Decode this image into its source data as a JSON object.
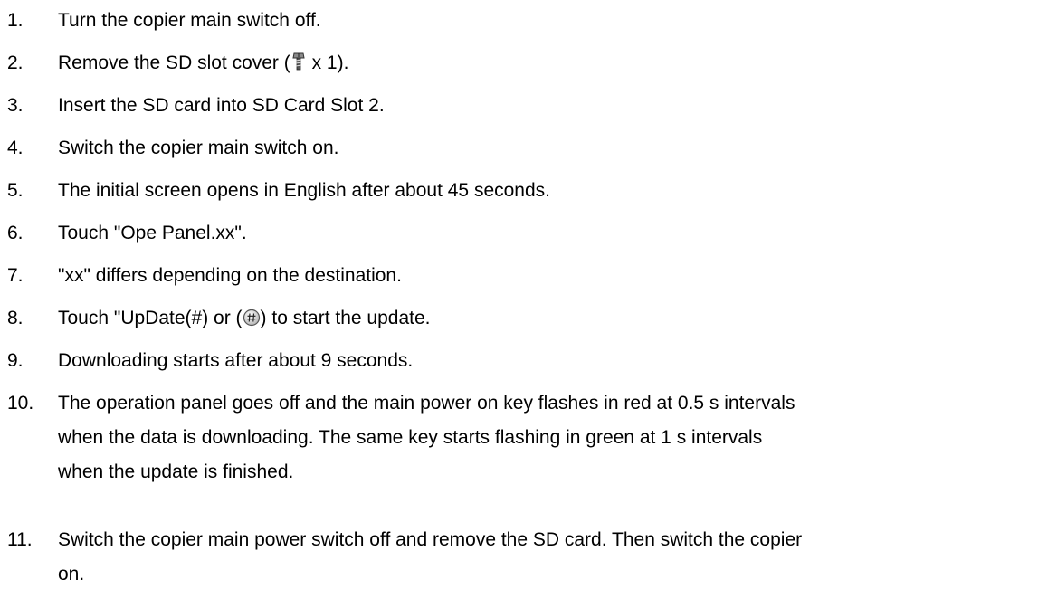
{
  "steps": [
    {
      "num": "1.",
      "text": "Turn the copier main switch off."
    },
    {
      "num": "2.",
      "before": "Remove the SD slot cover (",
      "after": " x 1).",
      "icon": "screw-icon"
    },
    {
      "num": "3.",
      "text": "Insert the SD card into SD Card Slot 2."
    },
    {
      "num": "4.",
      "text": "Switch the copier main switch on."
    },
    {
      "num": "5.",
      "text": "The initial screen opens in English after about 45 seconds."
    },
    {
      "num": "6.",
      "text": "Touch \"Ope Panel.xx\"."
    },
    {
      "num": "7.",
      "text": "\"xx\" differs depending on the destination."
    },
    {
      "num": "8.",
      "before": "Touch \"UpDate(#) or (",
      "after": ") to start the update.",
      "icon": "hash-key-icon"
    },
    {
      "num": "9.",
      "text": "Downloading starts after about 9 seconds."
    },
    {
      "num": "10.",
      "lines": [
        "The operation panel goes off and the main power on key flashes in red at 0.5 s intervals",
        "when the data is downloading. The same key starts flashing in green at 1 s intervals",
        "when the update is finished."
      ]
    },
    {
      "num": "11.",
      "lines": [
        "Switch the copier main power switch off and remove the SD card. Then switch the copier",
        "on."
      ]
    }
  ]
}
